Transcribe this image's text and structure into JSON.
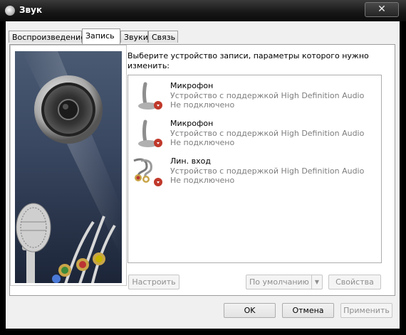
{
  "window": {
    "title": "Звук",
    "close_symbol": "✕"
  },
  "tabs": [
    {
      "label": "Воспроизведение",
      "active": false
    },
    {
      "label": "Запись",
      "active": true
    },
    {
      "label": "Звуки",
      "active": false
    },
    {
      "label": "Связь",
      "active": false
    }
  ],
  "recording": {
    "heading": "Выберите устройство записи, параметры которого нужно изменить:",
    "devices": [
      {
        "name": "Микрофон",
        "description": "Устройство с поддержкой High Definition Audio",
        "status": "Не подключено",
        "icon": "microphone-icon"
      },
      {
        "name": "Микрофон",
        "description": "Устройство с поддержкой High Definition Audio",
        "status": "Не подключено",
        "icon": "microphone-icon"
      },
      {
        "name": "Лин. вход",
        "description": "Устройство с поддержкой High Definition Audio",
        "status": "Не подключено",
        "icon": "line-in-icon"
      }
    ]
  },
  "panel_buttons": {
    "configure": "Настроить",
    "default": "По умолчанию",
    "properties": "Свойства"
  },
  "dialog_buttons": {
    "ok": "OK",
    "cancel": "Отмена",
    "apply": "Применить"
  },
  "colors": {
    "disconnected_badge": "#c0392b",
    "art_background": "#3a4862"
  }
}
